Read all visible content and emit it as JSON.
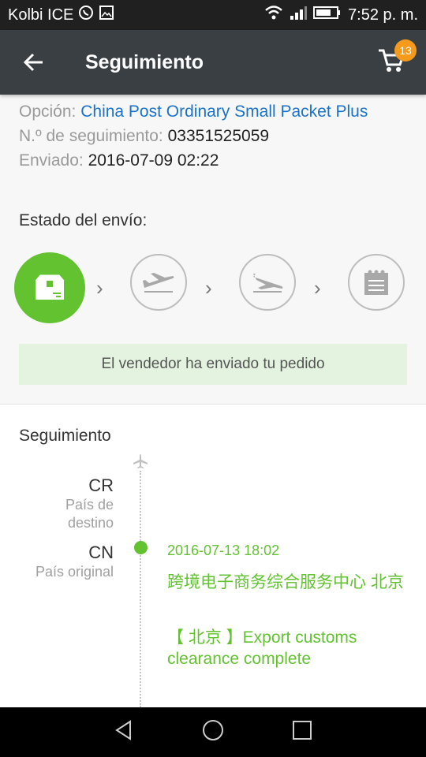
{
  "status_bar": {
    "carrier": "Kolbi ICE",
    "time": "7:52 p. m.",
    "icons": [
      "whatsapp-icon",
      "image-icon",
      "wifi-icon",
      "signal-icon",
      "battery-icon"
    ]
  },
  "app_bar": {
    "title": "Seguimiento",
    "cart_count": "13",
    "colors": {
      "bar": "#3a3f44",
      "badge": "#f59a1b"
    }
  },
  "info": {
    "option_label": "Opción:",
    "option_value": "China Post Ordinary Small Packet Plus",
    "tracking_label": "N.º de seguimiento:",
    "tracking_value": "03351525059",
    "sent_label": "Enviado:",
    "sent_value": "2016-07-09 02:22"
  },
  "shipment": {
    "label": "Estado del envío:",
    "steps": [
      "package-icon",
      "plane-takeoff-icon",
      "plane-landing-icon",
      "calendar-icon"
    ],
    "active_step": 0,
    "notice": "El vendedor ha enviado tu pedido"
  },
  "tracking": {
    "title": "Seguimiento",
    "destination_code": "CR",
    "destination_label": "País de destino",
    "origin_code": "CN",
    "origin_label": "País original",
    "event": {
      "date": "2016-07-13 18:02",
      "place": "跨境电子商务综合服务中心 北京",
      "description": "【 北京 】Export customs clearance complete"
    },
    "accent_color": "#62c230"
  },
  "nav_bar": {
    "buttons": [
      "back-triangle-icon",
      "home-circle-icon",
      "recents-square-icon"
    ]
  }
}
